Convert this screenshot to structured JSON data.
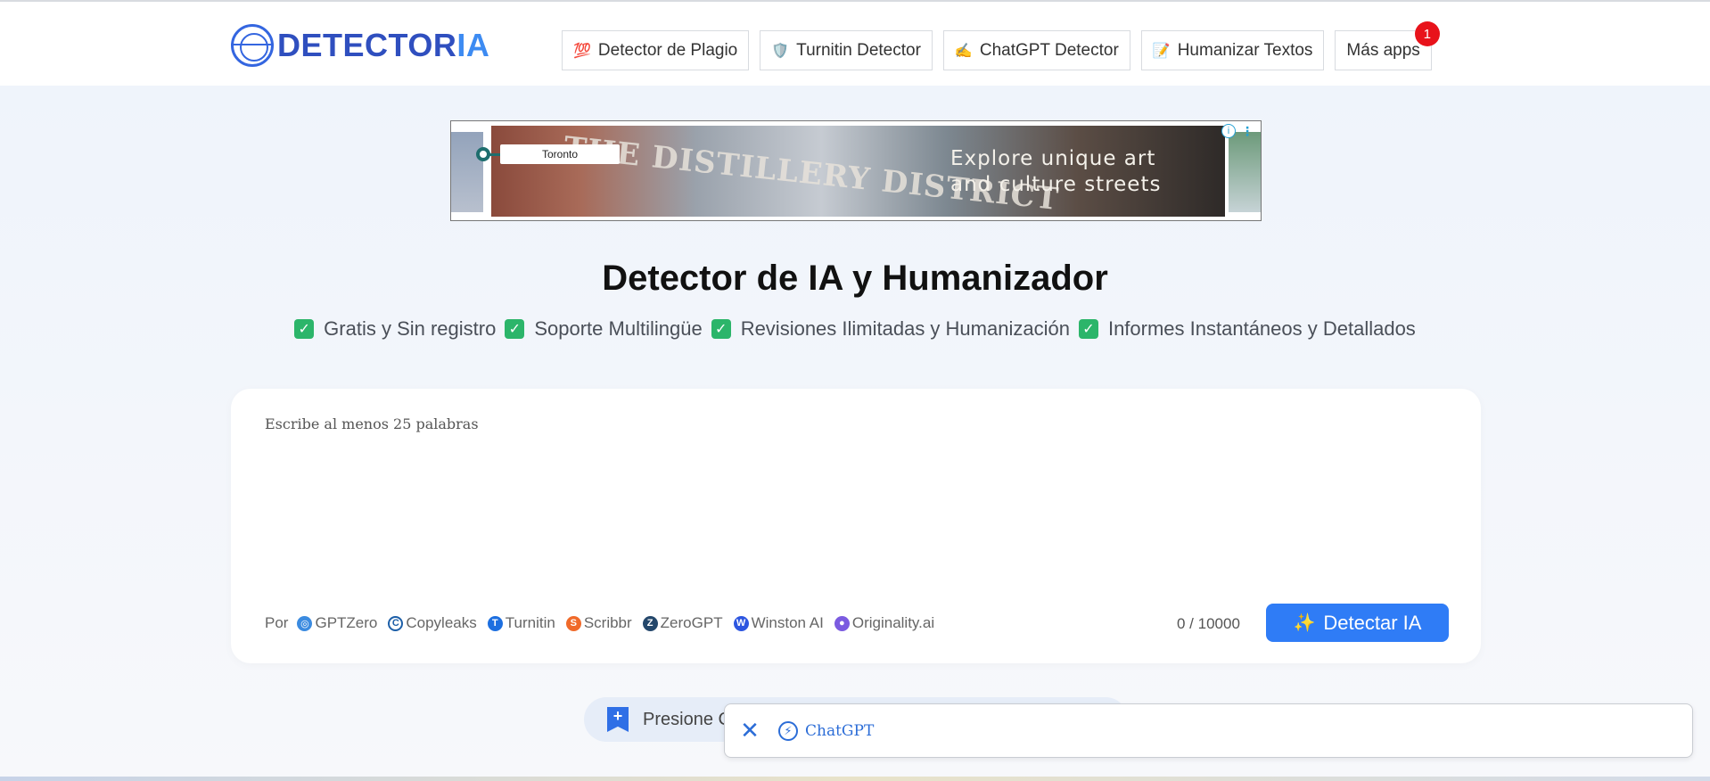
{
  "brand": {
    "logo_part1": "DETECTOR",
    "logo_part2": "IA"
  },
  "nav": {
    "items": [
      {
        "icon": "💯",
        "label": "Detector de Plagio"
      },
      {
        "icon": "🛡️",
        "label": "Turnitin Detector"
      },
      {
        "icon": "✍️",
        "label": "ChatGPT Detector"
      },
      {
        "icon": "📝",
        "label": "Humanizar Textos"
      },
      {
        "icon": "",
        "label": "Más apps"
      }
    ],
    "badge_count": "1"
  },
  "ad": {
    "location_pill": "Toronto",
    "sign_text": "THE DISTILLERY DISTRICT",
    "headline_line1": "Explore unique art",
    "headline_line2": "and culture streets",
    "info_glyph": "i",
    "menu_glyph": "⋮"
  },
  "hero": {
    "title": "Detector de IA y Humanizador",
    "features": [
      "Gratis y Sin registro",
      "Soporte Multilingüe",
      "Revisiones Ilimitadas y Humanización",
      "Informes Instantáneos y Detallados"
    ]
  },
  "editor": {
    "placeholder": "Escribe al menos 25 palabras",
    "by_label": "Por",
    "providers": [
      {
        "name": "GPTZero",
        "color": "#3b8be0"
      },
      {
        "name": "Copyleaks",
        "color": "#1d5fa8"
      },
      {
        "name": "Turnitin",
        "color": "#1d6fe0"
      },
      {
        "name": "Scribbr",
        "color": "#f06a2a"
      },
      {
        "name": "ZeroGPT",
        "color": "#24476b"
      },
      {
        "name": "Winston AI",
        "color": "#2d56e0"
      },
      {
        "name": "Originality.ai",
        "color": "#7b5be0"
      }
    ],
    "word_count": "0 / 10000",
    "detect_button": "Detectar IA",
    "detect_icon": "✨"
  },
  "press_bar": {
    "text": "Presione C"
  },
  "popup": {
    "close_glyph": "✕",
    "label": "ChatGPT"
  }
}
